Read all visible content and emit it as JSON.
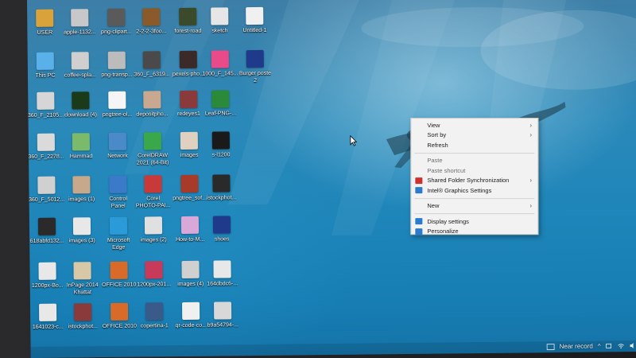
{
  "desktop": {
    "icons": [
      {
        "label": "USER",
        "color": "#d9a23b"
      },
      {
        "label": "apple-1132...",
        "color": "#c8c8c8"
      },
      {
        "label": "png-clipart...",
        "color": "#5a5a5a"
      },
      {
        "label": "2-2-2-3foo...",
        "color": "#8a5a2a"
      },
      {
        "label": "forest-road",
        "color": "#3a4a2a"
      },
      {
        "label": "sketch",
        "color": "#e6e6e6"
      },
      {
        "label": "Untitled-1",
        "color": "#f0f0f0"
      },
      {
        "label": "This PC",
        "color": "#5ab0e8"
      },
      {
        "label": "coffee-spla...",
        "color": "#cfcfcf"
      },
      {
        "label": "png-transp...",
        "color": "#bcbcbc"
      },
      {
        "label": "360_F_6319...",
        "color": "#4a4a4a"
      },
      {
        "label": "pexels-pho...",
        "color": "#3a2a2a"
      },
      {
        "label": "1000_F_145...",
        "color": "#e84a8a"
      },
      {
        "label": "Burger poste",
        "label2": "2",
        "color": "#1f3a8a"
      },
      {
        "label": "360_F_2105...",
        "color": "#d6d6d6"
      },
      {
        "label": "download (4)",
        "color": "#1a3a1a"
      },
      {
        "label": "pngtree-ol...",
        "color": "#f5f5f5"
      },
      {
        "label": "depositpho...",
        "color": "#c8a890"
      },
      {
        "label": "redeyes1",
        "color": "#8a3a3a"
      },
      {
        "label": "Leaf-PNG-...",
        "color": "#2a8a3a"
      },
      {
        "label": "360_F_2278...",
        "color": "#dadada"
      },
      {
        "label": "Hammad",
        "color": "#7aba6a"
      },
      {
        "label": "Network",
        "color": "#4a8ac8"
      },
      {
        "label": "CorelDRAW",
        "label2": "2021 (64-Bit)",
        "color": "#3aa84a"
      },
      {
        "label": "images",
        "color": "#e0d0c0"
      },
      {
        "label": "s-l1200",
        "color": "#1a1a1a"
      },
      {
        "label": "360_F_5012...",
        "color": "#d0d0d0"
      },
      {
        "label": "images (1)",
        "color": "#c8a88a"
      },
      {
        "label": "Control",
        "label2": "Panel",
        "color": "#3a7ac8"
      },
      {
        "label": "Corel",
        "label2": "PHOTO-PAI...",
        "color": "#c83a3a"
      },
      {
        "label": "pngtree_sof...",
        "color": "#a83a2a"
      },
      {
        "label": "istockphot...",
        "color": "#2a2a2a"
      },
      {
        "label": "618abfd132...",
        "color": "#2a2a2a"
      },
      {
        "label": "images (3)",
        "color": "#e8e8e8"
      },
      {
        "label": "Microsoft",
        "label2": "Edge",
        "color": "#2a9ad8"
      },
      {
        "label": "images (2)",
        "color": "#e0e0e0"
      },
      {
        "label": "How-to-M...",
        "color": "#d8a8d8"
      },
      {
        "label": "shoes",
        "color": "#1f3a8a"
      },
      {
        "label": "1200px-Bo...",
        "color": "#e8e8e8"
      },
      {
        "label": "InPage 2014",
        "label2": "Khattat",
        "color": "#d8c8a8"
      },
      {
        "label": "OFFICE 2010",
        "color": "#d86a2a"
      },
      {
        "label": "1200px-201...",
        "color": "#c83a5a"
      },
      {
        "label": "images (4)",
        "color": "#d0d0d0"
      },
      {
        "label": "164dbdc6-...",
        "color": "#e8e8e8"
      },
      {
        "label": "1641023-c...",
        "color": "#e8e8e8"
      },
      {
        "label": "istockphot...",
        "color": "#8a3a3a"
      },
      {
        "label": "OFFICE 2010",
        "color": "#d86a2a"
      },
      {
        "label": "copertina-1",
        "color": "#3a5a8a"
      },
      {
        "label": "qr-code-co...",
        "color": "#f0f0f0"
      },
      {
        "label": "b9a54794-...",
        "color": "#d8d8d8"
      }
    ]
  },
  "context_menu": {
    "items": [
      {
        "label": "View",
        "submenu": true,
        "icon": null
      },
      {
        "label": "Sort by",
        "submenu": true,
        "icon": null
      },
      {
        "label": "Refresh",
        "submenu": false,
        "icon": null
      },
      {
        "separator": true
      },
      {
        "label": "Paste",
        "submenu": false,
        "icon": null,
        "disabled": true
      },
      {
        "label": "Paste shortcut",
        "submenu": false,
        "icon": null,
        "disabled": true
      },
      {
        "label": "Shared Folder Synchronization",
        "submenu": true,
        "icon": "sync-icon",
        "icon_color": "#d03030"
      },
      {
        "label": "Intel® Graphics Settings",
        "submenu": false,
        "icon": "intel-graphics-icon",
        "icon_color": "#2a7ad0"
      },
      {
        "separator": true
      },
      {
        "label": "New",
        "submenu": true,
        "icon": null
      },
      {
        "separator": true
      },
      {
        "label": "Display settings",
        "submenu": false,
        "icon": "display-settings-icon",
        "icon_color": "#2a7ad0"
      },
      {
        "label": "Personalize",
        "submenu": false,
        "icon": "personalize-icon",
        "icon_color": "#2a7ad0"
      }
    ]
  },
  "taskbar": {
    "tray_text": "Near record"
  }
}
